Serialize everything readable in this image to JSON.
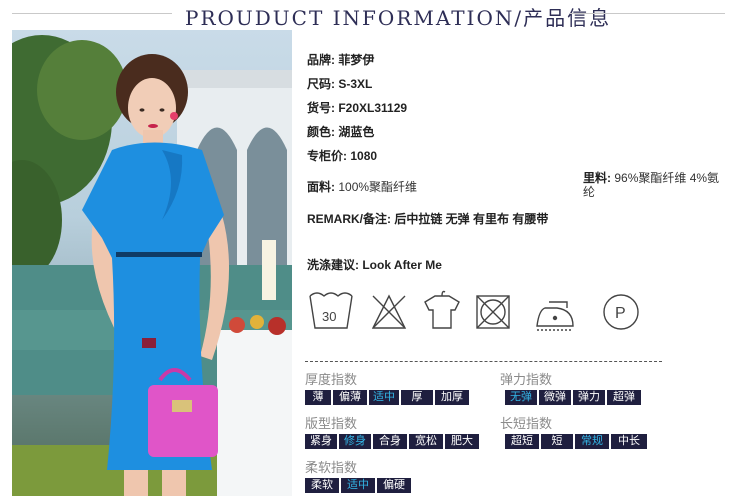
{
  "header": {
    "title": "PROUDUCT INFORMATION/产品信息"
  },
  "specs": {
    "brand_label": "品牌:",
    "brand": "菲梦伊",
    "size_label": "尺码:",
    "size": "S-3XL",
    "item_label": "货号:",
    "item": "F20XL31129",
    "color_label": "颜色:",
    "color": "湖蓝色",
    "price_label": "专柜价:",
    "price": "1080",
    "fabric_label": "面料:",
    "fabric": "100%聚酯纤维",
    "lining_label": "里料:",
    "lining": "96%聚酯纤维 4%氨纶",
    "remark_label": "REMARK/备注:",
    "remark": "后中拉链 无弹 有里布 有腰带",
    "wash_label": "洗涤建议:",
    "wash": "Look After Me"
  },
  "care_icons": {
    "wash_temp": "30",
    "names": [
      "wash-30-icon",
      "no-bleach-icon",
      "hang-dry-icon",
      "no-tumble-dry-icon",
      "iron-low-icon",
      "dry-clean-p-icon"
    ],
    "letter": "P"
  },
  "scales": {
    "thickness": {
      "title": "厚度指数",
      "options": [
        "薄",
        "偏薄",
        "适中",
        "厚",
        "加厚"
      ],
      "selected": 2
    },
    "elasticity": {
      "title": "弹力指数",
      "options": [
        "无弹",
        "微弹",
        "弹力",
        "超弹"
      ],
      "selected": 0
    },
    "fit": {
      "title": "版型指数",
      "options": [
        "紧身",
        "修身",
        "合身",
        "宽松",
        "肥大"
      ],
      "selected": 1
    },
    "length": {
      "title": "长短指数",
      "options": [
        "超短",
        "短",
        "常规",
        "中长"
      ],
      "selected": 2
    },
    "softness": {
      "title": "柔软指数",
      "options": [
        "柔软",
        "适中",
        "偏硬"
      ],
      "selected": 1
    }
  },
  "colors": {
    "dress": "#1e8fe0",
    "bag": "#e055c8",
    "scale_bg": "#1f1f3f",
    "scale_selected": "#33b5e5",
    "title": "#2e2e56"
  }
}
